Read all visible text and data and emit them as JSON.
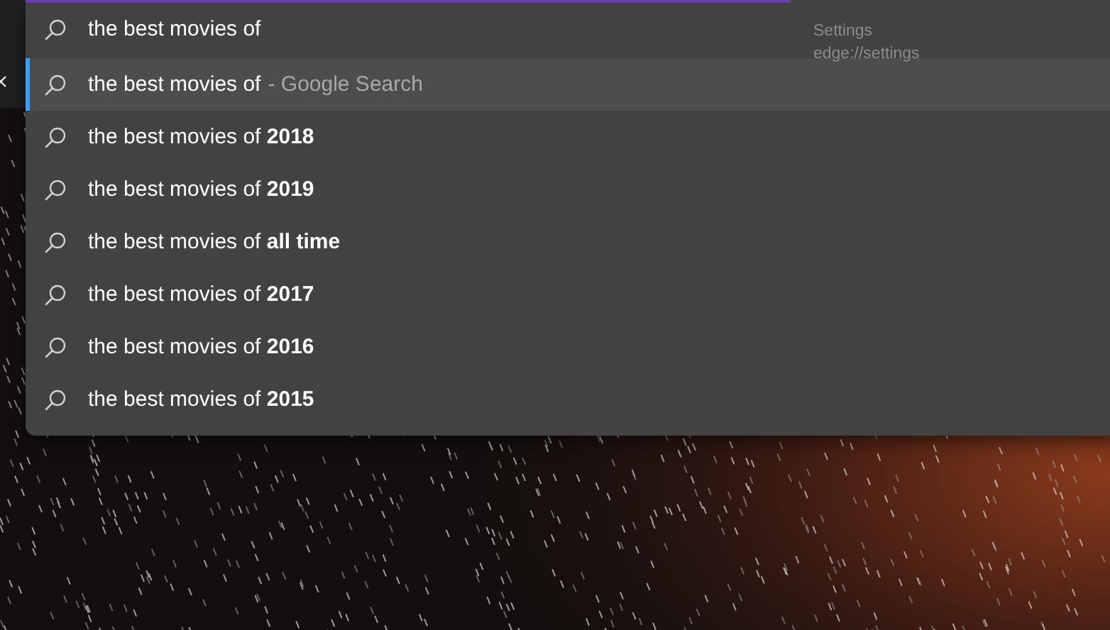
{
  "loading_bar": {
    "level": 0.7
  },
  "search": {
    "value": "the best movies of"
  },
  "tooltip": {
    "title": "Settings",
    "url": "edge://settings"
  },
  "suggestions": [
    {
      "text": "the best movies of",
      "suffix": "- Google Search",
      "selected": true
    },
    {
      "text": "the best movies of **2018**",
      "selected": false
    },
    {
      "text": "the best movies of **2019**",
      "selected": false
    },
    {
      "text": "the best movies of **all time**",
      "selected": false
    },
    {
      "text": "the best movies of **2017**",
      "selected": false
    },
    {
      "text": "the best movies of **2016**",
      "selected": false
    },
    {
      "text": "the best movies of **2015**",
      "selected": false
    }
  ]
}
